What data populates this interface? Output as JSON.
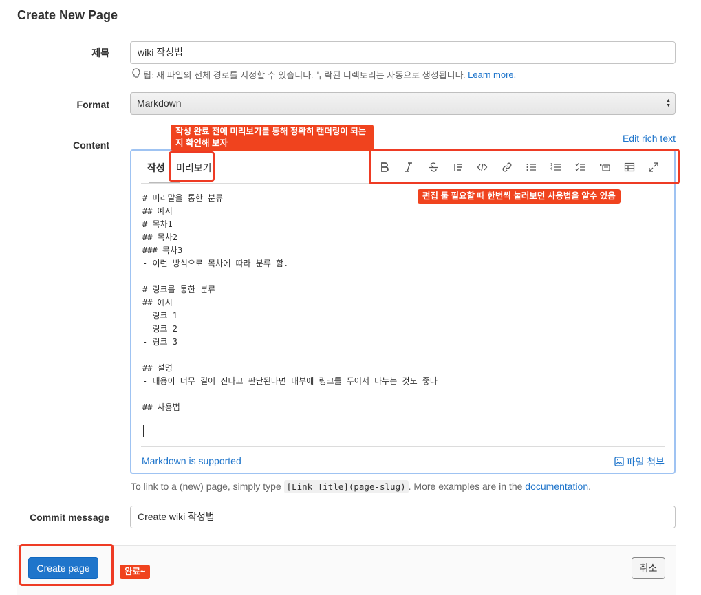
{
  "page": {
    "title": "Create New Page"
  },
  "form": {
    "title_label": "제목",
    "title_value": "wiki 작성법",
    "tip_text": "팁: 새 파일의 전체 경로를 지정할 수 있습니다. 누락된 디렉토리는 자동으로 생성됩니다.",
    "tip_link": "Learn more.",
    "format_label": "Format",
    "format_value": "Markdown",
    "content_label": "Content",
    "edit_rich_text": "Edit rich text",
    "commit_label": "Commit message",
    "commit_value": "Create wiki 작성법"
  },
  "editor": {
    "tabs": [
      "작성",
      "미리보기"
    ],
    "toolbar_icons": [
      "bold-icon",
      "italic-icon",
      "strikethrough-icon",
      "quote-icon",
      "code-icon",
      "link-icon",
      "bullet-list-icon",
      "numbered-list-icon",
      "task-list-icon",
      "collapsible-icon",
      "table-icon",
      "fullscreen-icon"
    ],
    "content": "# 머리말을 통한 분류\n## 예시\n# 목차1\n## 목차2\n### 목차3\n- 이런 방식으로 목차에 따라 분류 함.\n\n# 링크를 통한 분류\n## 예시\n- 링크 1\n- 링크 2\n- 링크 3\n\n## 설명\n- 내용이 너무 길어 진다고 판단된다면 내부에 링크를 두어서 나누는 것도 좋다\n\n## 사용법",
    "markdown_supported": "Markdown is supported",
    "attach_file": "파일 첨부"
  },
  "help": {
    "prefix": "To link to a (new) page, simply type",
    "code": "[Link Title](page-slug)",
    "middle": ". More examples are in the",
    "link": "documentation",
    "suffix": "."
  },
  "actions": {
    "create_label": "Create page",
    "cancel_label": "취소"
  },
  "annotations": {
    "preview_note": "작성 완료 전에 미리보기를 통해 정확히 랜더링이 되는지 확인해 보자",
    "toolbar_note": "편집 툴 필요할 때 한번씩 눌러보면 사용법을 알수 있음",
    "done_note": "완료~"
  },
  "colors": {
    "accent": "#1f75cb",
    "annotation": "#ee3b24"
  }
}
